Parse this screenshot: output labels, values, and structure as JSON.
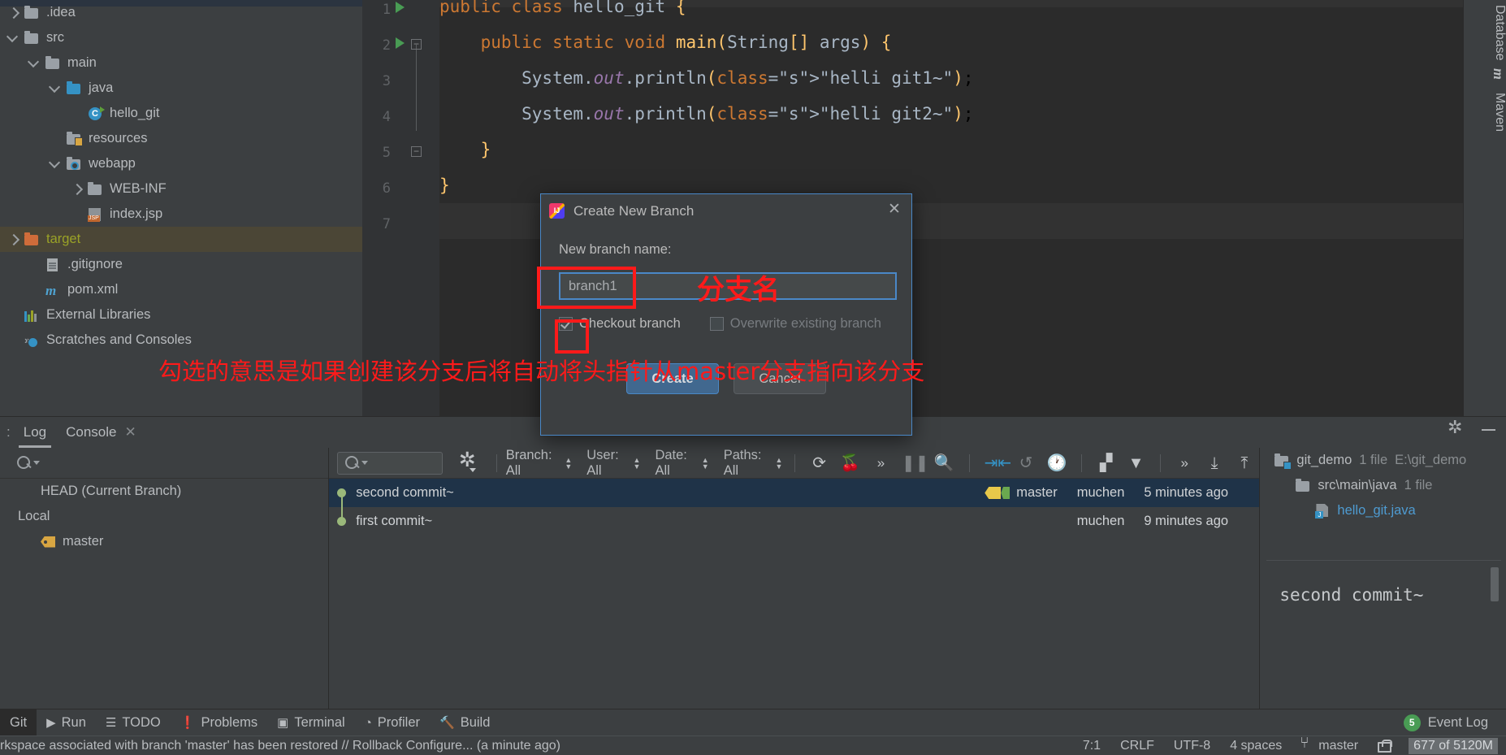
{
  "project_tree": {
    "items": [
      {
        "label": ".idea",
        "icon": "folder-icon",
        "indent": 0,
        "arrow": "closed",
        "type": "folder"
      },
      {
        "label": "src",
        "icon": "folder-icon",
        "indent": 0,
        "arrow": "open",
        "type": "folder"
      },
      {
        "label": "main",
        "icon": "folder-icon",
        "indent": 1,
        "arrow": "open",
        "type": "folder"
      },
      {
        "label": "java",
        "icon": "source-folder-icon",
        "indent": 2,
        "arrow": "open",
        "type": "folder-blue"
      },
      {
        "label": "hello_git",
        "icon": "java-class-icon",
        "indent": 3,
        "arrow": "none",
        "type": "class"
      },
      {
        "label": "resources",
        "icon": "resources-folder-icon",
        "indent": 2,
        "arrow": "none",
        "type": "folder-res"
      },
      {
        "label": "webapp",
        "icon": "webapp-folder-icon",
        "indent": 2,
        "arrow": "open",
        "type": "folder-web"
      },
      {
        "label": "WEB-INF",
        "icon": "folder-icon",
        "indent": 3,
        "arrow": "closed",
        "type": "folder"
      },
      {
        "label": "index.jsp",
        "icon": "jsp-file-icon",
        "indent": 3,
        "arrow": "none",
        "type": "jsp"
      },
      {
        "label": "target",
        "icon": "folder-icon",
        "indent": 0,
        "arrow": "closed",
        "type": "folder-orange",
        "selected": true
      },
      {
        "label": ".gitignore",
        "icon": "gitignore-file-icon",
        "indent": 1,
        "arrow": "none",
        "type": "gitignore"
      },
      {
        "label": "pom.xml",
        "icon": "maven-file-icon",
        "indent": 1,
        "arrow": "none",
        "type": "maven"
      },
      {
        "label": "External Libraries",
        "icon": "libraries-icon",
        "indent": 0,
        "arrow": "none",
        "type": "libs"
      },
      {
        "label": "Scratches and Consoles",
        "icon": "scratches-icon",
        "indent": 0,
        "arrow": "none",
        "type": "scratch"
      }
    ]
  },
  "editor": {
    "lines": [
      {
        "no": "1",
        "text": "public class hello_git {"
      },
      {
        "no": "2",
        "text": "    public static void main(String[] args) {"
      },
      {
        "no": "3",
        "text": "        System.out.println(\"helli git1~\");"
      },
      {
        "no": "4",
        "text": "        System.out.println(\"helli git2~\");"
      },
      {
        "no": "5",
        "text": "    }"
      },
      {
        "no": "6",
        "text": "}"
      },
      {
        "no": "7",
        "text": ""
      }
    ]
  },
  "right_tool_tabs": {
    "database": "Database",
    "maven": "Maven"
  },
  "dialog": {
    "title": "Create New Branch",
    "close_label": "✕",
    "field_label": "New branch name:",
    "branch_name_value": "branch1",
    "branch_name_placeholder": "",
    "checkout_label": "Checkout branch",
    "checkout_checked": true,
    "overwrite_label": "Overwrite existing branch",
    "overwrite_checked": false,
    "create_label": "Create",
    "cancel_label": "Cancel"
  },
  "annotations": {
    "branch_name_note": "分支名",
    "checkout_note": "勾选的意思是如果创建该分支后将自动将头指针从master分支指向该分支"
  },
  "git_window": {
    "tabs": [
      {
        "label": "Log",
        "active": true,
        "closable": false
      },
      {
        "label": "Console",
        "active": false,
        "closable": true,
        "close_label": "✕"
      }
    ],
    "branch_pane": {
      "search_placeholder": "",
      "rows": [
        {
          "label": "HEAD (Current Branch)",
          "indent": 1,
          "arrow": "none",
          "icon": "none"
        },
        {
          "label": "Local",
          "indent": 0,
          "arrow": "open",
          "icon": "none"
        },
        {
          "label": "master",
          "indent": 1,
          "arrow": "none",
          "icon": "branch-tag-icon"
        }
      ]
    },
    "commit_toolbar": {
      "search_placeholder": "",
      "filters": [
        {
          "label": "Branch: All"
        },
        {
          "label": "User: All"
        },
        {
          "label": "Date: All"
        },
        {
          "label": "Paths: All"
        }
      ],
      "icons": [
        "refresh-icon",
        "cherry-pick-icon",
        "more-chevrons-icon",
        "pause-icon",
        "search-icon"
      ],
      "right_icons": [
        "collapse-arrows-icon",
        "revert-icon",
        "history-clock-icon",
        "group-icon",
        "filter-icon",
        "more-chevrons-icon",
        "expand-all-icon",
        "collapse-all-icon"
      ]
    },
    "commits": [
      {
        "subject": "second commit~",
        "branch": "master",
        "author": "muchen",
        "date": "5 minutes ago",
        "selected": true,
        "has_branch_chip": true
      },
      {
        "subject": "first commit~",
        "branch": "",
        "author": "muchen",
        "date": "9 minutes ago",
        "selected": false,
        "has_branch_chip": false
      }
    ],
    "details": {
      "rows": [
        {
          "label": "git_demo",
          "count": "1 file",
          "path": "E:\\git_demo",
          "indent": 0,
          "arrow": "open",
          "icon": "project-folder-icon"
        },
        {
          "label": "src\\main\\java",
          "count": "1 file",
          "path": "",
          "indent": 1,
          "arrow": "open",
          "icon": "folder-icon"
        },
        {
          "label": "hello_git.java",
          "count": "",
          "path": "",
          "indent": 2,
          "arrow": "none",
          "icon": "java-file-icon"
        }
      ],
      "message": "second commit~"
    }
  },
  "bottom_bar": {
    "items": [
      {
        "label": "Git",
        "icon": "none",
        "active": true
      },
      {
        "label": "Run",
        "icon": "run-icon",
        "active": false
      },
      {
        "label": "TODO",
        "icon": "todo-icon",
        "active": false
      },
      {
        "label": "Problems",
        "icon": "problems-icon",
        "active": false
      },
      {
        "label": "Terminal",
        "icon": "terminal-icon",
        "active": false
      },
      {
        "label": "Profiler",
        "icon": "profiler-icon",
        "active": false
      },
      {
        "label": "Build",
        "icon": "build-hammer-icon",
        "active": false
      }
    ],
    "event_log": {
      "label": "Event Log",
      "badge": "5"
    }
  },
  "status_bar": {
    "message": "rkspace associated with branch 'master' has been restored // Rollback   Configure... (a minute ago)",
    "caret": "7:1",
    "line_separator": "CRLF",
    "encoding": "UTF-8",
    "indent": "4 spaces",
    "branch": "master",
    "memory": "677 of 5120M"
  }
}
